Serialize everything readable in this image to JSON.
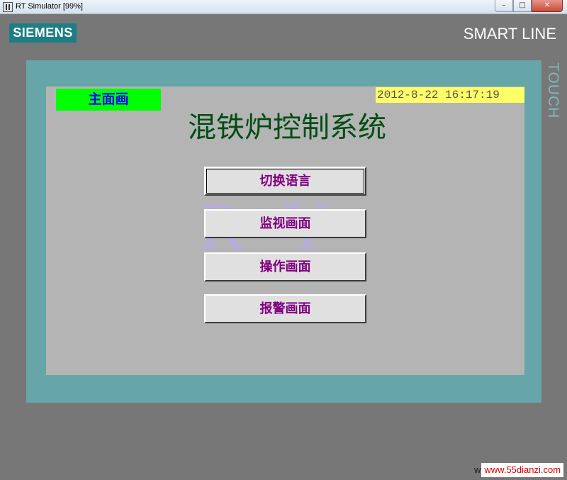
{
  "window": {
    "title": "RT Simulator [99%]",
    "controls": {
      "minimize": "–",
      "maximize": "□",
      "close": "✕"
    }
  },
  "device": {
    "brand": "SIEMENS",
    "product_line": "SMART LINE",
    "side_label": "TOUCH"
  },
  "hmi": {
    "screen_name": "主面画",
    "datetime": "2012-8-22 16:17:19",
    "title": "混铁炉控制系统",
    "watermark": "RY",
    "buttons": [
      {
        "label": "切换语言"
      },
      {
        "label": "监视画面"
      },
      {
        "label": "操作画面"
      },
      {
        "label": "报警画面"
      }
    ]
  },
  "footer": {
    "lead": "w",
    "url": "www.55dianzi.com"
  },
  "colors": {
    "frame": "#777777",
    "bezel": "#66a5a8",
    "screen": "#b4b4b4",
    "screen_name_bg": "#00ff00",
    "screen_name_text": "#0000ff",
    "datetime_bg": "#ffff66",
    "title_text": "#004d14",
    "button_text": "#800080",
    "brand_bg": "#1d7f84"
  },
  "icons": {
    "app": "rt-simulator-icon"
  }
}
